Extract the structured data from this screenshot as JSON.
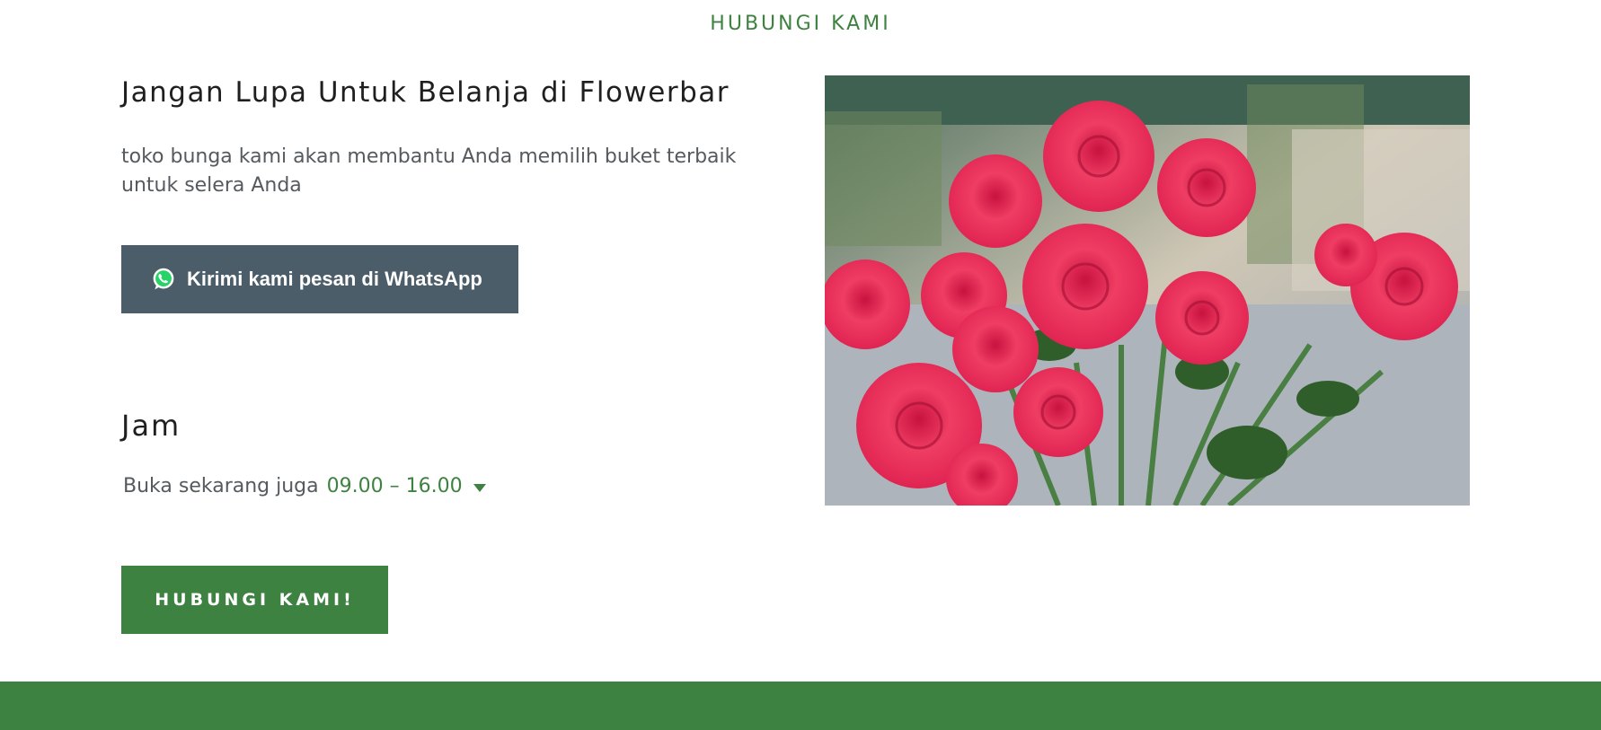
{
  "section": {
    "heading": "HUBUNGI KAMI"
  },
  "intro": {
    "title": "Jangan Lupa Untuk Belanja di Flowerbar",
    "description": "toko bunga kami akan membantu Anda memilih buket terbaik untuk selera Anda"
  },
  "whatsapp": {
    "label": "Kirimi kami pesan di WhatsApp",
    "icon": "whatsapp-icon"
  },
  "hours": {
    "title": "Jam",
    "status": "Buka sekarang juga",
    "time": "09.00 – 16.00"
  },
  "cta": {
    "label": "HUBUNGI KAMI!"
  },
  "colors": {
    "accent": "#3d8241",
    "whatsapp_button": "#4a5d69",
    "text_dark": "#1f1f1f",
    "text_muted": "#555a5e"
  }
}
